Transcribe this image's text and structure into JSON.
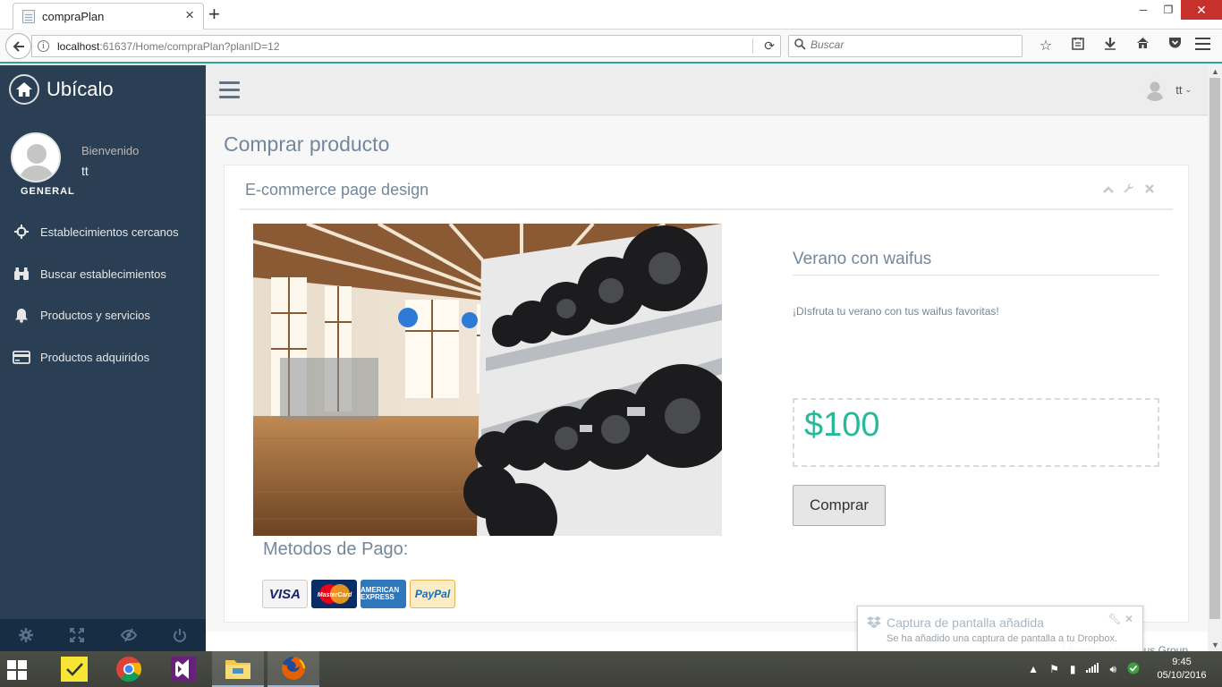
{
  "browser": {
    "tab_title": "compraPlan",
    "tab_close": "×",
    "new_tab": "+",
    "url_host": "localhost",
    "url_rest": ":61637/Home/compraPlan?planID=12",
    "search_placeholder": "Buscar",
    "window_minimize": "─",
    "window_restore": "❐",
    "window_close": "✕"
  },
  "sidebar": {
    "brand": "Ubícalo",
    "welcome": "Bienvenido",
    "user": "tt",
    "role": "GENERAL",
    "items": [
      {
        "label": "Establecimientos cercanos",
        "icon": "crosshair-icon"
      },
      {
        "label": "Buscar establecimientos",
        "icon": "binoculars-icon"
      },
      {
        "label": "Productos y servicios",
        "icon": "bell-icon"
      },
      {
        "label": "Productos adquiridos",
        "icon": "credit-card-icon"
      }
    ],
    "footer_icons": [
      "gear-icon",
      "fullscreen-icon",
      "eye-slash-icon",
      "power-icon"
    ]
  },
  "topnav": {
    "user_name": "tt",
    "caret": "⌄"
  },
  "page": {
    "title": "Comprar producto",
    "panel_title": "E-commerce page design",
    "payment_title": "Metodos de Pago:",
    "payment_methods": [
      "VISA",
      "MasterCard",
      "AMERICAN EXPRESS",
      "PayPal"
    ],
    "product_name": "Verano con waifus",
    "product_description": "¡DIsfruta tu verano con tus waifus favoritas!",
    "price": "$100",
    "buy_label": "Comprar",
    "footer_text": "Ubícalo - Luminous Group"
  },
  "notification": {
    "title": "Captura de pantalla añadida",
    "body": "Se ha añadido una captura de pantalla a tu Dropbox."
  },
  "taskbar": {
    "time": "9:45",
    "date": "05/10/2016"
  },
  "colors": {
    "sidebar_bg": "#2a3f54",
    "accent_green": "#26b99a",
    "text_muted": "#73879c"
  }
}
